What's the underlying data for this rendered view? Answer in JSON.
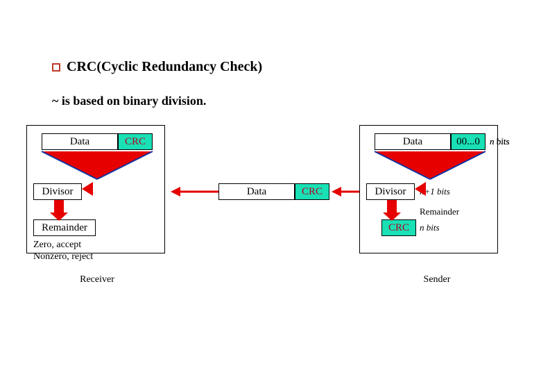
{
  "heading": {
    "title": "CRC(Cyclic Redundancy Check)",
    "subtitle": "~ is based on binary division."
  },
  "receiver": {
    "data": "Data",
    "crc": "CRC",
    "divisor": "Divisor",
    "remainder": "Remainder",
    "note1": "Zero, accept",
    "note2": "Nonzero, reject",
    "caption": "Receiver"
  },
  "sender": {
    "data": "Data",
    "zeros": "00...0",
    "divisor": "Divisor",
    "crc": "CRC",
    "n_bits": "n bits",
    "n1_bits": "n+1 bits",
    "remainder_label": "Remainder",
    "caption": "Sender"
  },
  "transit": {
    "data": "Data",
    "crc": "CRC"
  }
}
